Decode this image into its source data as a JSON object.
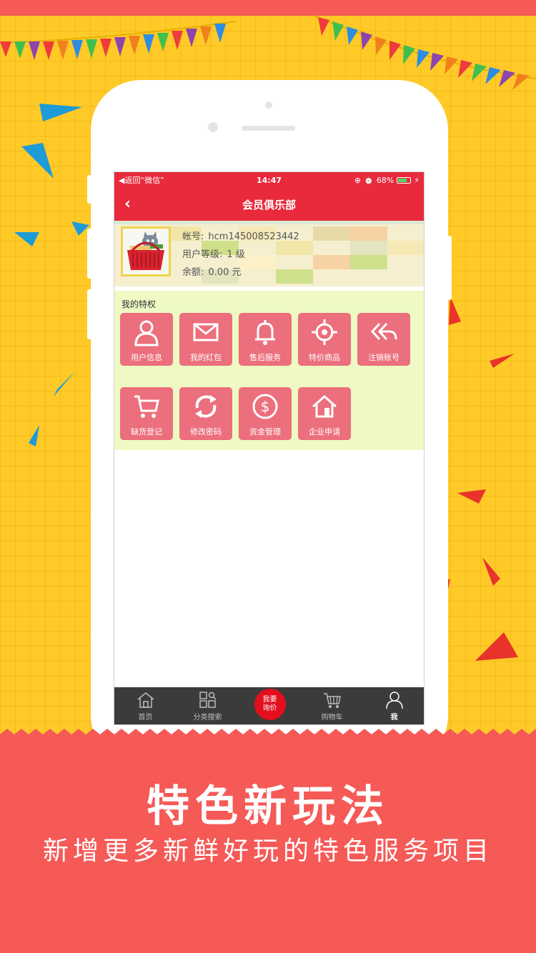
{
  "status_bar": {
    "back_text": "◀返回“微信”",
    "time": "14:47",
    "battery": "68%"
  },
  "header": {
    "back_icon": "chevron-left-icon",
    "title": "会员俱乐部"
  },
  "profile": {
    "account_label": "帐号:",
    "account_value": "hcm145008523442",
    "level_label": "用户等级:",
    "level_value": "1 级",
    "balance_label": "余额:",
    "balance_value": "0.00 元"
  },
  "privileges": {
    "section_label": "我的特权",
    "items": [
      {
        "label": "用户信息",
        "icon": "user-icon"
      },
      {
        "label": "我的红包",
        "icon": "envelope-icon"
      },
      {
        "label": "售后服务",
        "icon": "bell-icon"
      },
      {
        "label": "特价商品",
        "icon": "target-icon"
      },
      {
        "label": "注销账号",
        "icon": "reply-all-icon"
      },
      {
        "label": "缺货登记",
        "icon": "cart-icon"
      },
      {
        "label": "修改密码",
        "icon": "refresh-icon"
      },
      {
        "label": "资金管理",
        "icon": "dollar-icon"
      },
      {
        "label": "企业申请",
        "icon": "home-icon"
      }
    ]
  },
  "tabbar": {
    "items": [
      {
        "label": "首页",
        "icon": "home-icon"
      },
      {
        "label": "分类搜索",
        "icon": "category-search-icon"
      },
      {
        "label": "我要\n询价",
        "icon": "ask-price-button"
      },
      {
        "label": "购物车",
        "icon": "cart-icon"
      },
      {
        "label": "我",
        "icon": "person-icon"
      }
    ],
    "ask_line1": "我要",
    "ask_line2": "询价",
    "active": "我"
  },
  "banner": {
    "headline": "特色新玩法",
    "subline": "新增更多新鲜好玩的特色服务项目"
  },
  "colors": {
    "accent": "#e82a3c",
    "tile": "#ec6f7d",
    "banner": "#f55a57",
    "background": "#ffca28",
    "privilege_bg": "#eef9c4"
  }
}
